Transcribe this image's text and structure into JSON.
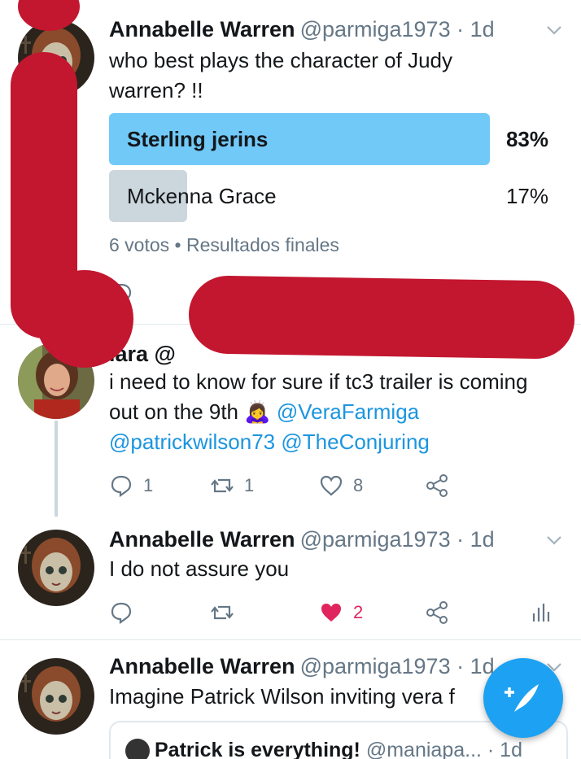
{
  "tweet1": {
    "name": "Annabelle Warren",
    "handle": "@parmiga1973 · 1d",
    "text": "who best plays the character of Judy warren? !!",
    "poll": [
      {
        "label": "Sterling jerins",
        "percent_text": "83%",
        "fraction": 0.83,
        "winner": true
      },
      {
        "label": "Mckenna Grace",
        "percent_text": "17%",
        "fraction": 0.17,
        "winner": false
      }
    ],
    "poll_meta": "6 votos • Resultados finales"
  },
  "tweet2": {
    "name": "iara @",
    "text_line1": "i need to know for sure if tc3 trailer is coming",
    "text_line2_prefix": "out on the 9th",
    "emoji": "🙇‍♀️",
    "mention1": "@VeraFarmiga",
    "mention2": "@patrickwilson73",
    "mention3": "@TheConjuring",
    "replies": "1",
    "retweets": "1",
    "likes": "8"
  },
  "tweet3": {
    "name": "Annabelle Warren",
    "handle": "@parmiga1973 · 1d",
    "text": "I do not assure you",
    "likes": "2",
    "liked": true
  },
  "tweet4": {
    "name": "Annabelle Warren",
    "handle": "@parmiga1973 · 1d",
    "text": "Imagine Patrick Wilson inviting vera f",
    "quote_name": "Patrick is everything!",
    "quote_handle": "@maniapa... · 1d"
  },
  "colors": {
    "accent": "#1da1f2",
    "poll_winner": "#71c9f8",
    "poll_other": "#ccd6dd",
    "like_red": "#e0245e",
    "redaction": "#c3162f",
    "text_secondary": "#657786"
  },
  "icons": [
    "chevron-down-icon",
    "reply-icon",
    "retweet-icon",
    "like-icon",
    "share-icon",
    "analytics-icon",
    "compose-tweet-icon"
  ]
}
